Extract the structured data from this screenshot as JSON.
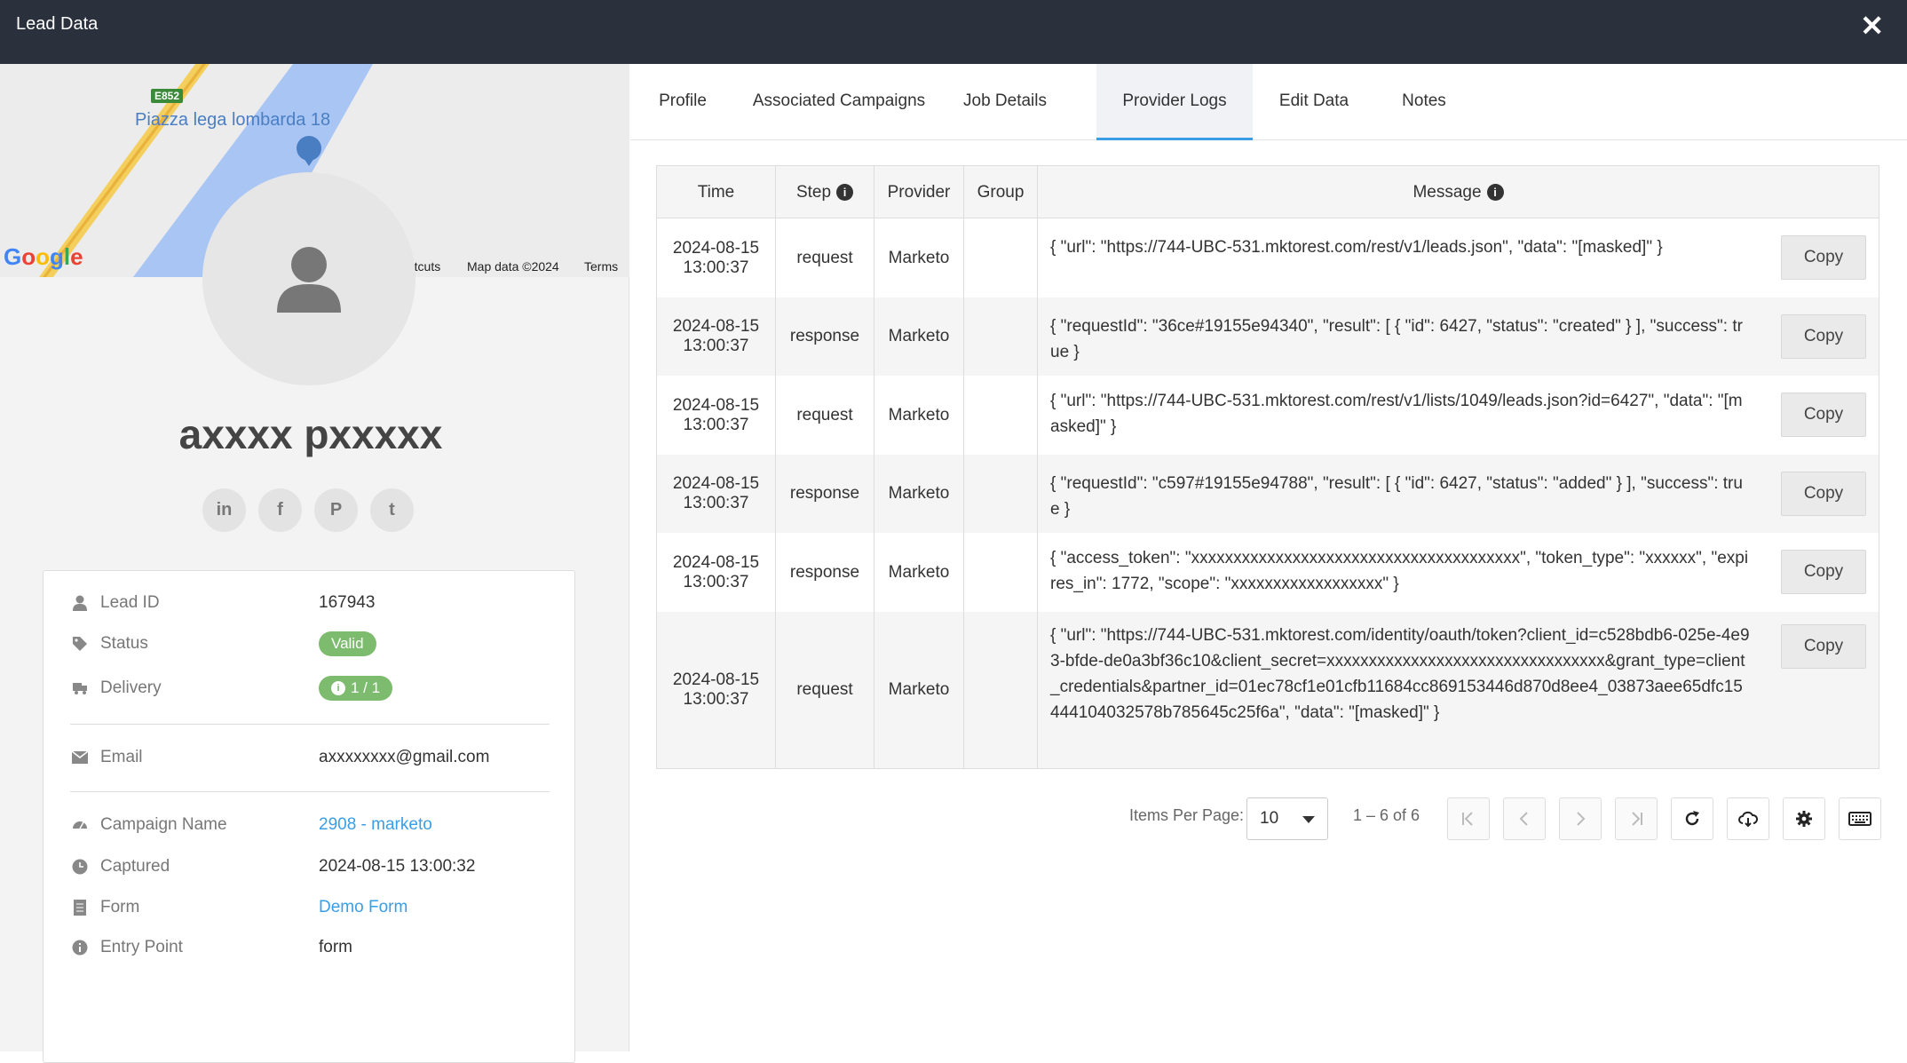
{
  "header": {
    "title": "Lead Data",
    "close_label": "✕"
  },
  "map": {
    "place": "Piazza lega lombarda 18",
    "road": "E852",
    "google": "Google",
    "shortcuts": "rtcuts",
    "mapdata": "Map data ©2024",
    "terms": "Terms"
  },
  "profile": {
    "name": "axxxx pxxxxx",
    "socials": [
      "in",
      "f",
      "P",
      "t"
    ]
  },
  "details": {
    "lead_id_label": "Lead ID",
    "lead_id": "167943",
    "status_label": "Status",
    "status": "Valid",
    "delivery_label": "Delivery",
    "delivery": "1 / 1",
    "email_label": "Email",
    "email": "axxxxxxxx@gmail.com",
    "campaign_label": "Campaign Name",
    "campaign": "2908 - marketo",
    "captured_label": "Captured",
    "captured": "2024-08-15 13:00:32",
    "form_label": "Form",
    "form": "Demo Form",
    "entry_label": "Entry Point",
    "entry": "form"
  },
  "tabs": [
    "Profile",
    "Associated Campaigns",
    "Job Details",
    "Provider Logs",
    "Edit Data",
    "Notes"
  ],
  "active_tab": "Provider Logs",
  "table": {
    "headers": {
      "time": "Time",
      "step": "Step",
      "provider": "Provider",
      "group": "Group",
      "message": "Message"
    },
    "copy_label": "Copy",
    "rows": [
      {
        "time": "2024-08-15 13:00:37",
        "step": "request",
        "provider": "Marketo",
        "group": "",
        "message": "{ \"url\": \"https://744-UBC-531.mktorest.com/rest/v1/leads.json\", \"data\": \"[masked]\" }"
      },
      {
        "time": "2024-08-15 13:00:37",
        "step": "response",
        "provider": "Marketo",
        "group": "",
        "message": "{ \"requestId\": \"36ce#19155e94340\", \"result\": [ { \"id\": 6427, \"status\": \"created\" } ], \"success\": true }"
      },
      {
        "time": "2024-08-15 13:00:37",
        "step": "request",
        "provider": "Marketo",
        "group": "",
        "message": "{ \"url\": \"https://744-UBC-531.mktorest.com/rest/v1/lists/1049/leads.json?id=6427\", \"data\": \"[masked]\" }"
      },
      {
        "time": "2024-08-15 13:00:37",
        "step": "response",
        "provider": "Marketo",
        "group": "",
        "message": "{ \"requestId\": \"c597#19155e94788\", \"result\": [ { \"id\": 6427, \"status\": \"added\" } ], \"success\": true }"
      },
      {
        "time": "2024-08-15 13:00:37",
        "step": "response",
        "provider": "Marketo",
        "group": "",
        "message": "{ \"access_token\": \"xxxxxxxxxxxxxxxxxxxxxxxxxxxxxxxxxxxxxxx\", \"token_type\": \"xxxxxx\", \"expires_in\": 1772, \"scope\": \"xxxxxxxxxxxxxxxxxx\" }"
      },
      {
        "time": "2024-08-15 13:00:37",
        "step": "request",
        "provider": "Marketo",
        "group": "",
        "message": "{ \"url\": \"https://744-UBC-531.mktorest.com/identity/oauth/token?client_id=c528bdb6-025e-4e93-bfde-de0a3bf36c10&client_secret=xxxxxxxxxxxxxxxxxxxxxxxxxxxxxxxxx&grant_type=client_credentials&partner_id=01ec78cf1e01cfb11684cc869153446d870d8ee4_03873aee65dfc15444104032578b785645c25f6a\", \"data\": \"[masked]\" }"
      }
    ]
  },
  "pagination": {
    "items_per_page_label": "Items Per Page:",
    "items_per_page": "10",
    "range": "1 – 6 of 6"
  }
}
